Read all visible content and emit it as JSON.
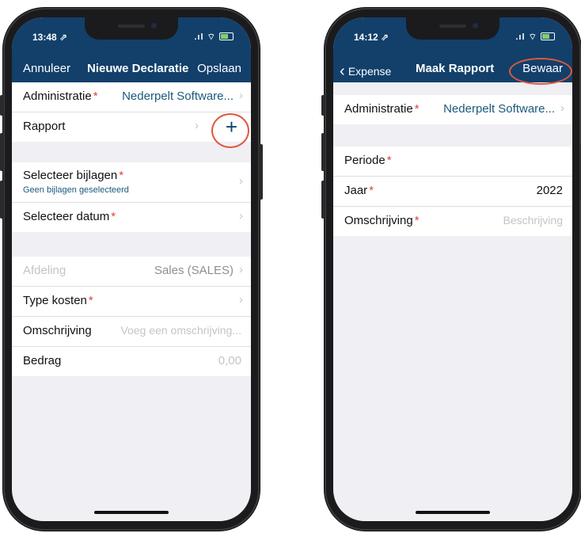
{
  "left": {
    "status_time": "13:48 ⇗",
    "nav": {
      "cancel": "Annuleer",
      "title": "Nieuwe Declaratie",
      "save": "Opslaan"
    },
    "section1": [
      {
        "label": "Administratie",
        "required": "*",
        "value": "Nederpelt Software..."
      },
      {
        "label": "Rapport",
        "required": "",
        "value": ""
      }
    ],
    "section2": {
      "attachments_label": "Selecteer bijlagen",
      "attachments_required": "*",
      "attachments_sub": "Geen bijlagen geselecteerd",
      "date_label": "Selecteer datum",
      "date_required": "*"
    },
    "section3": {
      "department_label": "Afdeling",
      "department_value": "Sales (SALES)",
      "cost_type_label": "Type kosten",
      "cost_type_required": "*",
      "description_label": "Omschrijving",
      "description_placeholder": "Voeg een omschrijving...",
      "amount_label": "Bedrag",
      "amount_placeholder": "0,00"
    },
    "add_icon": "plus-icon"
  },
  "right": {
    "status_time": "14:12 ⇗",
    "nav": {
      "back": "Expense",
      "title": "Maak Rapport",
      "save": "Bewaar"
    },
    "section1": {
      "label": "Administratie",
      "required": "*",
      "value": "Nederpelt Software..."
    },
    "section2": {
      "period_label": "Periode",
      "period_required": "*",
      "year_label": "Jaar",
      "year_required": "*",
      "year_value": "2022",
      "description_label": "Omschrijving",
      "description_required": "*",
      "description_placeholder": "Beschrijving"
    }
  },
  "colors": {
    "nav": "#12406b",
    "accent_text": "#1b5a7a",
    "required": "#e0403b",
    "highlight_ring": "#e0573f"
  }
}
